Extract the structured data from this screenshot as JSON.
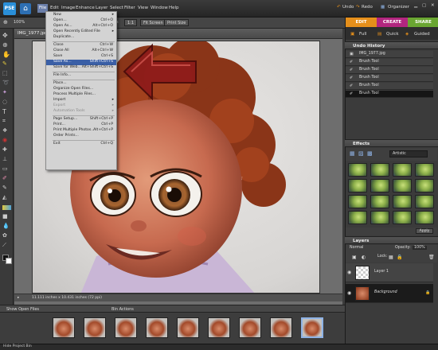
{
  "app": {
    "logo_text": "PSE"
  },
  "menubar": [
    "File",
    "Edit",
    "Image",
    "Enhance",
    "Layer",
    "Select",
    "Filter",
    "View",
    "Window",
    "Help"
  ],
  "topbar_right": {
    "undo": "Undo",
    "redo": "Redo",
    "organizer": "Organizer"
  },
  "options": {
    "value1": "100%",
    "btn1": "Resize Windows To Fit",
    "value2": "s",
    "btn2": "1:1",
    "btn3": "Fit Screen",
    "btn4": "Print Size"
  },
  "document": {
    "title": "IMG_1977.jpg",
    "status": "11.111 inches x 10.431 inches (72 ppi)"
  },
  "file_menu": {
    "items": [
      {
        "label": "New",
        "shortcut": "",
        "submenu": true,
        "state": "normal"
      },
      {
        "label": "Open...",
        "shortcut": "Ctrl+O",
        "state": "normal"
      },
      {
        "label": "Open As...",
        "shortcut": "Alt+Ctrl+O",
        "state": "normal"
      },
      {
        "label": "Open Recently Edited File",
        "shortcut": "",
        "submenu": true,
        "state": "normal"
      },
      {
        "label": "Duplicate...",
        "shortcut": "",
        "state": "normal"
      },
      {
        "sep": true
      },
      {
        "label": "Close",
        "shortcut": "Ctrl+W",
        "state": "normal"
      },
      {
        "label": "Close All",
        "shortcut": "Alt+Ctrl+W",
        "state": "normal"
      },
      {
        "label": "Save",
        "shortcut": "Ctrl+S",
        "state": "normal"
      },
      {
        "label": "Save As...",
        "shortcut": "Shift+Ctrl+S",
        "state": "highlighted"
      },
      {
        "label": "Save for Web...",
        "shortcut": "Alt+Shift+Ctrl+S",
        "state": "normal"
      },
      {
        "sep": true
      },
      {
        "label": "File Info...",
        "shortcut": "",
        "state": "normal"
      },
      {
        "sep": true
      },
      {
        "label": "Place...",
        "shortcut": "",
        "state": "normal"
      },
      {
        "label": "Organize Open Files...",
        "shortcut": "",
        "state": "normal"
      },
      {
        "label": "Process Multiple Files...",
        "shortcut": "",
        "state": "normal"
      },
      {
        "label": "Import",
        "shortcut": "",
        "submenu": true,
        "state": "normal"
      },
      {
        "label": "Export",
        "shortcut": "",
        "submenu": true,
        "state": "disabled"
      },
      {
        "label": "Automation Tools",
        "shortcut": "",
        "submenu": true,
        "state": "disabled"
      },
      {
        "sep": true
      },
      {
        "label": "Page Setup...",
        "shortcut": "Shift+Ctrl+P",
        "state": "normal"
      },
      {
        "label": "Print...",
        "shortcut": "Ctrl+P",
        "state": "normal"
      },
      {
        "label": "Print Multiple Photos...",
        "shortcut": "Alt+Ctrl+P",
        "state": "normal"
      },
      {
        "label": "Order Prints...",
        "shortcut": "",
        "state": "normal"
      },
      {
        "sep": true
      },
      {
        "label": "Exit",
        "shortcut": "Ctrl+Q",
        "state": "normal"
      }
    ]
  },
  "mode_tabs": {
    "edit": "EDIT",
    "create": "CREATE",
    "share": "SHARE"
  },
  "edit_subtabs": {
    "full": "Full",
    "quick": "Quick",
    "guided": "Guided"
  },
  "undo_history": {
    "title": "Undo History",
    "items": [
      "IMG_1977.jpg",
      "Brush Tool",
      "Brush Tool",
      "Brush Tool",
      "Brush Tool",
      "Brush Tool"
    ],
    "selected_index": 5
  },
  "effects": {
    "title": "Effects",
    "category": "Artistic",
    "apply_label": "Apply"
  },
  "layers": {
    "title": "Layers",
    "blend_mode": "Normal",
    "opacity_label": "Opacity:",
    "opacity_value": "100%",
    "lock_label": "Lock:",
    "items": [
      {
        "name": "Layer 1",
        "selected": false
      },
      {
        "name": "Background",
        "selected": true
      }
    ]
  },
  "project_bin": {
    "show_label": "Show Open Files",
    "actions_label": "Bin Actions",
    "thumbnail_count": 9,
    "selected_thumb": 8,
    "hide_label": "Hide Project Bin"
  },
  "colors": {
    "accent": "#2d6fb3",
    "edit_tab": "#e58f1b",
    "create_tab": "#b2267f",
    "share_tab": "#6aa632",
    "menu_highlight": "#3a5fa6"
  }
}
